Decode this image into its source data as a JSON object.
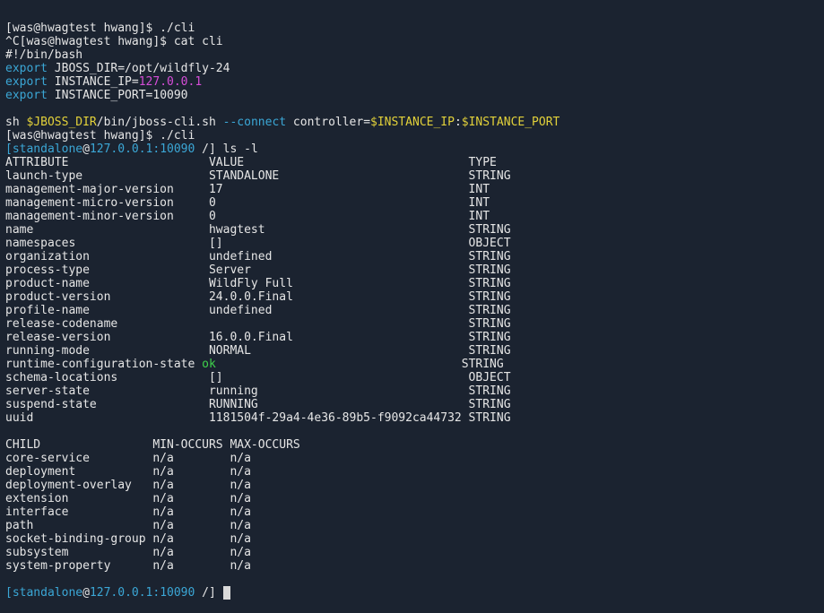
{
  "colors": {
    "background": "#1b2330",
    "text": "#e6e6e6",
    "blue": "#3ba7d6",
    "magenta": "#d64dd8",
    "yellow": "#e2d13a",
    "green": "#3fd24b"
  },
  "lines": [
    [
      {
        "t": "[was@hwagtest hwang]$ ./cli",
        "c": "white"
      }
    ],
    [
      {
        "t": "^C[was@hwagtest hwang]$ cat cli",
        "c": "white"
      }
    ],
    [
      {
        "t": "#!/bin/bash",
        "c": "white"
      }
    ],
    [
      {
        "t": "export",
        "c": "blue"
      },
      {
        "t": " JBOSS_DIR=/opt/wildfly-24",
        "c": "white"
      }
    ],
    [
      {
        "t": "export",
        "c": "blue"
      },
      {
        "t": " INSTANCE_IP=",
        "c": "white"
      },
      {
        "t": "127.0.0.1",
        "c": "mag"
      }
    ],
    [
      {
        "t": "export",
        "c": "blue"
      },
      {
        "t": " INSTANCE_PORT=10090",
        "c": "white"
      }
    ],
    [
      {
        "t": "",
        "c": "white"
      }
    ],
    [
      {
        "t": "sh ",
        "c": "white"
      },
      {
        "t": "$JBOSS_DIR",
        "c": "yel"
      },
      {
        "t": "/bin/jboss-cli.sh ",
        "c": "white"
      },
      {
        "t": "--connect",
        "c": "blue"
      },
      {
        "t": " controller=",
        "c": "white"
      },
      {
        "t": "$INSTANCE_IP",
        "c": "yel"
      },
      {
        "t": ":",
        "c": "white"
      },
      {
        "t": "$INSTANCE_PORT",
        "c": "yel"
      }
    ],
    [
      {
        "t": "[was@hwagtest hwang]$ ./cli",
        "c": "white"
      }
    ],
    [
      {
        "t": "[",
        "c": "blue"
      },
      {
        "t": "standalone",
        "c": "blue"
      },
      {
        "t": "@",
        "c": "white"
      },
      {
        "t": "127.0.0.1:10090",
        "c": "blue"
      },
      {
        "t": " /] ls -l",
        "c": "white"
      }
    ],
    [
      {
        "t": "ATTRIBUTE                    VALUE                                TYPE",
        "c": "white"
      }
    ],
    [
      {
        "t": "launch-type                  STANDALONE                           STRING",
        "c": "white"
      }
    ],
    [
      {
        "t": "management-major-version     17                                   INT",
        "c": "white"
      }
    ],
    [
      {
        "t": "management-micro-version     0                                    INT",
        "c": "white"
      }
    ],
    [
      {
        "t": "management-minor-version     0                                    INT",
        "c": "white"
      }
    ],
    [
      {
        "t": "name                         hwagtest                             STRING",
        "c": "white"
      }
    ],
    [
      {
        "t": "namespaces                   []                                   OBJECT",
        "c": "white"
      }
    ],
    [
      {
        "t": "organization                 undefined                            STRING",
        "c": "white"
      }
    ],
    [
      {
        "t": "process-type                 Server                               STRING",
        "c": "white"
      }
    ],
    [
      {
        "t": "product-name                 WildFly Full                         STRING",
        "c": "white"
      }
    ],
    [
      {
        "t": "product-version              24.0.0.Final                         STRING",
        "c": "white"
      }
    ],
    [
      {
        "t": "profile-name                 undefined                            STRING",
        "c": "white"
      }
    ],
    [
      {
        "t": "release-codename                                                  STRING",
        "c": "white"
      }
    ],
    [
      {
        "t": "release-version              16.0.0.Final                         STRING",
        "c": "white"
      }
    ],
    [
      {
        "t": "running-mode                 NORMAL                               STRING",
        "c": "white"
      }
    ],
    [
      {
        "t": "runtime-configuration-state ",
        "c": "white"
      },
      {
        "t": "ok",
        "c": "green"
      },
      {
        "t": "                                   STRING",
        "c": "white"
      }
    ],
    [
      {
        "t": "schema-locations             []                                   OBJECT",
        "c": "white"
      }
    ],
    [
      {
        "t": "server-state                 running                              STRING",
        "c": "white"
      }
    ],
    [
      {
        "t": "suspend-state                RUNNING                              STRING",
        "c": "white"
      }
    ],
    [
      {
        "t": "uuid                         1181504f-29a4-4e36-89b5-f9092ca44732 STRING",
        "c": "white"
      }
    ],
    [
      {
        "t": "",
        "c": "white"
      }
    ],
    [
      {
        "t": "CHILD                MIN-OCCURS MAX-OCCURS",
        "c": "white"
      }
    ],
    [
      {
        "t": "core-service         n/a        n/a",
        "c": "white"
      }
    ],
    [
      {
        "t": "deployment           n/a        n/a",
        "c": "white"
      }
    ],
    [
      {
        "t": "deployment-overlay   n/a        n/a",
        "c": "white"
      }
    ],
    [
      {
        "t": "extension            n/a        n/a",
        "c": "white"
      }
    ],
    [
      {
        "t": "interface            n/a        n/a",
        "c": "white"
      }
    ],
    [
      {
        "t": "path                 n/a        n/a",
        "c": "white"
      }
    ],
    [
      {
        "t": "socket-binding-group n/a        n/a",
        "c": "white"
      }
    ],
    [
      {
        "t": "subsystem            n/a        n/a",
        "c": "white"
      }
    ],
    [
      {
        "t": "system-property      n/a        n/a",
        "c": "white"
      }
    ],
    [
      {
        "t": "",
        "c": "white"
      }
    ],
    [
      {
        "t": "[",
        "c": "blue"
      },
      {
        "t": "standalone",
        "c": "blue"
      },
      {
        "t": "@",
        "c": "white"
      },
      {
        "t": "127.0.0.1:10090",
        "c": "blue"
      },
      {
        "t": " /] ",
        "c": "white"
      }
    ]
  ],
  "cursor": "block"
}
